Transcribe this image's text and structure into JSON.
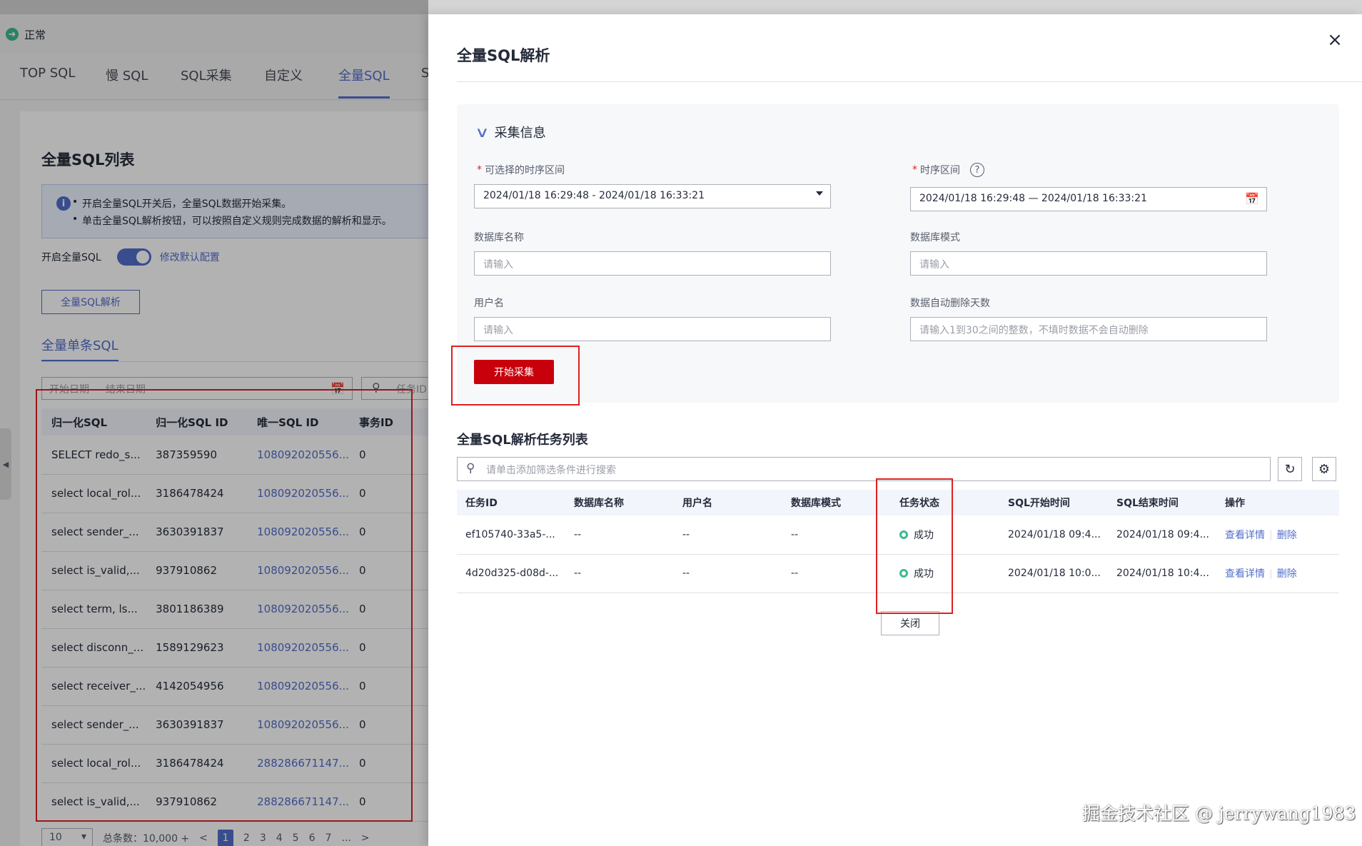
{
  "status": {
    "text": "正常"
  },
  "tabs": [
    "TOP SQL",
    "慢 SQL",
    "SQL采集",
    "自定义",
    "全量SQL",
    "S"
  ],
  "list_page": {
    "title": "全量SQL列表",
    "info_lines": [
      "开启全量SQL开关后，全量SQL数据开始采集。",
      "单击全量SQL解析按钮，可以按照自定义规则完成数据的解析和显示。"
    ],
    "toggle_label": "开启全量SQL",
    "modify_link": "修改默认配置",
    "parse_button": "全量SQL解析",
    "subtab": "全量单条SQL",
    "date_placeholder": "开始日期 — 结束日期",
    "search_placeholder": "任务ID",
    "table_headers": [
      "归一化SQL",
      "归一化SQL ID",
      "唯一SQL ID",
      "事务ID"
    ],
    "rows": [
      [
        "SELECT redo_s...",
        "387359590",
        "108092020556...",
        "0"
      ],
      [
        "select local_rol...",
        "3186478424",
        "108092020556...",
        "0"
      ],
      [
        "select sender_...",
        "3630391837",
        "108092020556...",
        "0"
      ],
      [
        "select is_valid,...",
        "937910862",
        "108092020556...",
        "0"
      ],
      [
        "select term, ls...",
        "3801186389",
        "108092020556...",
        "0"
      ],
      [
        "select disconn_...",
        "1589129623",
        "108092020556...",
        "0"
      ],
      [
        "select receiver_...",
        "4142054956",
        "108092020556...",
        "0"
      ],
      [
        "select sender_...",
        "3630391837",
        "108092020556...",
        "0"
      ],
      [
        "select local_rol...",
        "3186478424",
        "288286671147...",
        "0"
      ],
      [
        "select is_valid,...",
        "937910862",
        "288286671147...",
        "0"
      ]
    ],
    "pager": {
      "size": "10",
      "total": "总条数：10,000 +",
      "prev": "<",
      "pages": [
        "1",
        "2",
        "3",
        "4",
        "5",
        "6",
        "7",
        "..."
      ],
      "next": ">"
    }
  },
  "drawer": {
    "title": "全量SQL解析",
    "close": "×",
    "section": "采集信息",
    "fields": {
      "optional_range_label": "可选择的时序区间",
      "optional_range_value": "2024/01/18 16:29:48 - 2024/01/18 16:33:21",
      "range_label": "时序区间",
      "range_value": "2024/01/18 16:29:48 — 2024/01/18 16:33:21",
      "db_name_label": "数据库名称",
      "db_name_placeholder": "请输入",
      "db_schema_label": "数据库模式",
      "db_schema_placeholder": "请输入",
      "user_label": "用户名",
      "user_placeholder": "请输入",
      "auto_delete_label": "数据自动删除天数",
      "auto_delete_placeholder": "请输入1到30之间的整数，不填时数据不会自动删除"
    },
    "start_button": "开始采集",
    "task_list_title": "全量SQL解析任务列表",
    "task_search_placeholder": "请单击添加筛选条件进行搜索",
    "task_headers": [
      "任务ID",
      "数据库名称",
      "用户名",
      "数据库模式",
      "任务状态",
      "SQL开始时间",
      "SQL结束时间",
      "操作"
    ],
    "tasks": [
      {
        "id": "ef105740-33a5-...",
        "db": "--",
        "user": "--",
        "schema": "--",
        "status": "成功",
        "start": "2024/01/18 09:4...",
        "end": "2024/01/18 09:4...",
        "view": "查看详情",
        "delete": "删除"
      },
      {
        "id": "4d20d325-d08d-...",
        "db": "--",
        "user": "--",
        "schema": "--",
        "status": "成功",
        "start": "2024/01/18 10:0...",
        "end": "2024/01/18 10:4...",
        "view": "查看详情",
        "delete": "删除"
      }
    ],
    "close_button": "关闭"
  },
  "colors": {
    "brand": "#526ecc",
    "primary_button": "#c7000b",
    "success": "#3dbb8c",
    "annotation": "#e02020"
  },
  "watermark": "掘金技术社区 @ jerrywang1983"
}
